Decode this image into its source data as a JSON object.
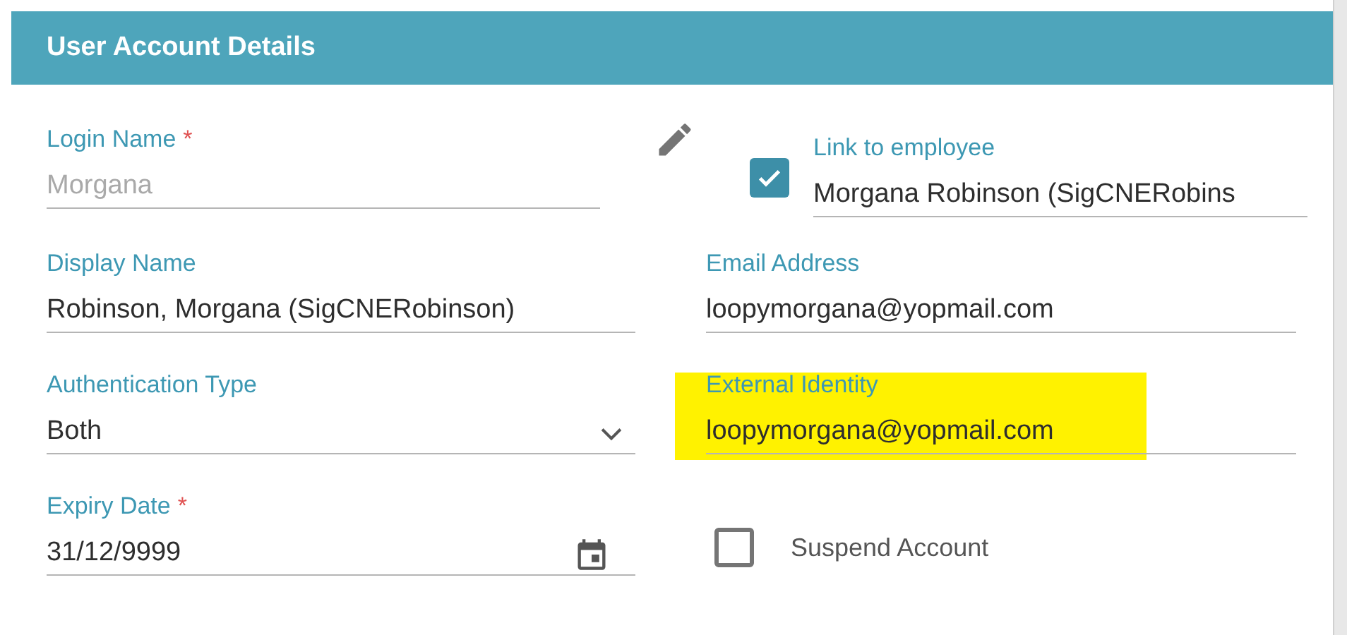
{
  "panel": {
    "title": "User Account Details"
  },
  "login_name": {
    "label": "Login Name",
    "required_mark": "*",
    "value": "Morgana",
    "disabled": true
  },
  "link_to_employee": {
    "checked": true,
    "label": "Link to employee",
    "value": "Morgana Robinson (SigCNERobins"
  },
  "display_name": {
    "label": "Display Name",
    "value": "Robinson, Morgana (SigCNERobinson)"
  },
  "email_address": {
    "label": "Email Address",
    "value": "loopymorgana@yopmail.com"
  },
  "authentication_type": {
    "label": "Authentication Type",
    "value": "Both"
  },
  "external_identity": {
    "label": "External Identity",
    "value": "loopymorgana@yopmail.com",
    "highlighted": true
  },
  "expiry_date": {
    "label": "Expiry Date",
    "required_mark": "*",
    "value": "31/12/9999"
  },
  "suspend_account": {
    "label": "Suspend Account",
    "checked": false
  }
}
